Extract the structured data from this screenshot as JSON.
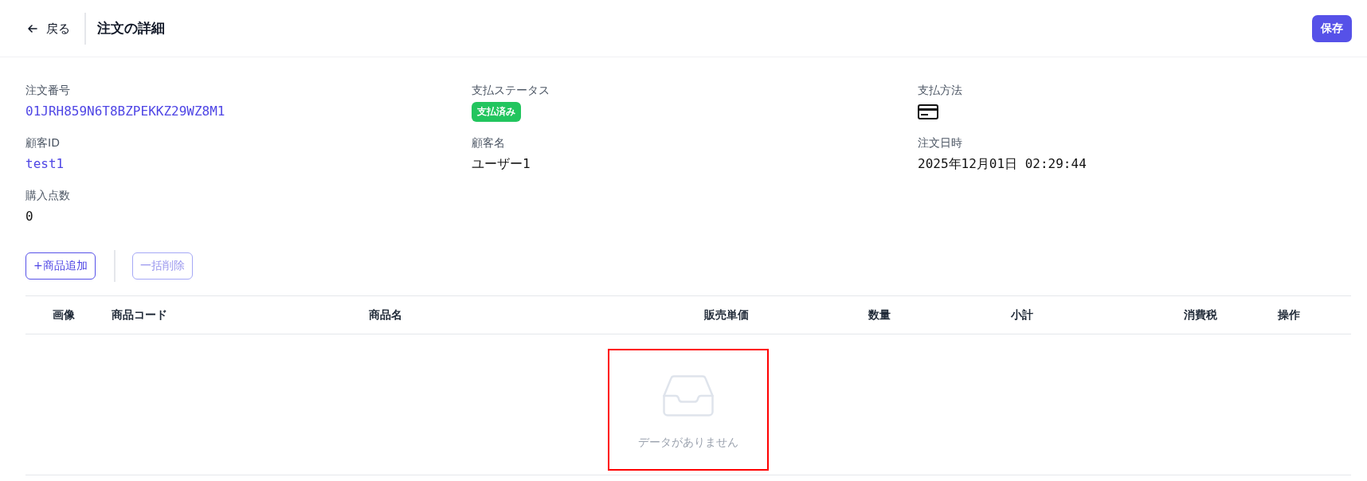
{
  "header": {
    "back_label": "戻る",
    "title": "注文の詳細",
    "save_label": "保存"
  },
  "details": [
    {
      "kind": "link",
      "label": "注文番号",
      "value": "01JRH859N6T8BZPEKKZ29WZ8M1"
    },
    {
      "kind": "badge",
      "label": "支払ステータス",
      "value": "支払済み"
    },
    {
      "kind": "card_icon",
      "label": "支払方法"
    },
    {
      "kind": "link",
      "label": "顧客ID",
      "value": "test1"
    },
    {
      "kind": "text",
      "label": "顧客名",
      "value": "ユーザー1"
    },
    {
      "kind": "text",
      "label": "注文日時",
      "value": "2025年12月01日 02:29:44"
    },
    {
      "kind": "text",
      "label": "購入点数",
      "value": "0"
    }
  ],
  "actions": [
    {
      "label": "+商品追加",
      "disabled": false
    },
    {
      "label": "一括削除",
      "disabled": true
    }
  ],
  "table": {
    "columns": [
      "画像",
      "商品コード",
      "商品名",
      "販売単価",
      "数量",
      "小計",
      "消費税",
      "操作"
    ],
    "empty_message": "データがありません",
    "highlighted": true
  }
}
